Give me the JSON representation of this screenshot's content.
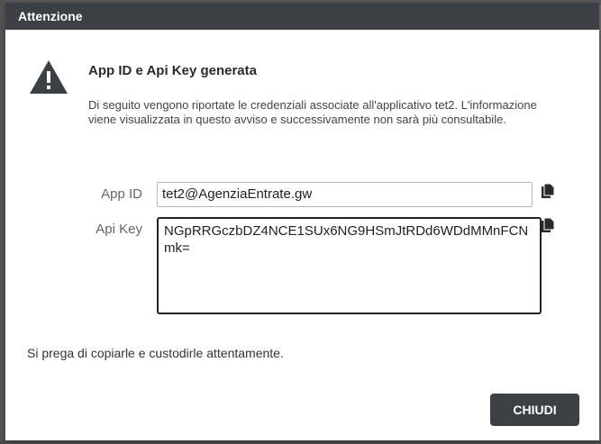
{
  "dialog": {
    "title": "Attenzione"
  },
  "message": {
    "icon": "warning-icon",
    "title": "App ID e Api Key generata",
    "text": "Di seguito vengono riportate le credenziali associate all'applicativo tet2. L'informazione viene visualizzata in questo avviso e successivamente non sarà più consultabile."
  },
  "fields": {
    "app_id_label": "App ID",
    "app_id_value": "tet2@AgenziaEntrate.gw",
    "api_key_label": "Api Key",
    "api_key_value": "NGpRRGczbDZ4NCE1SUx6NG9HSmJtRDd6WDdMMnFCNmk="
  },
  "footer": {
    "note": "Si prega di copiarle e custodirle attentamente.",
    "close_label": "CHIUDI"
  },
  "colors": {
    "header": "#3c3f46",
    "button": "#3c3f46",
    "overlay": "#6e6e6e"
  }
}
